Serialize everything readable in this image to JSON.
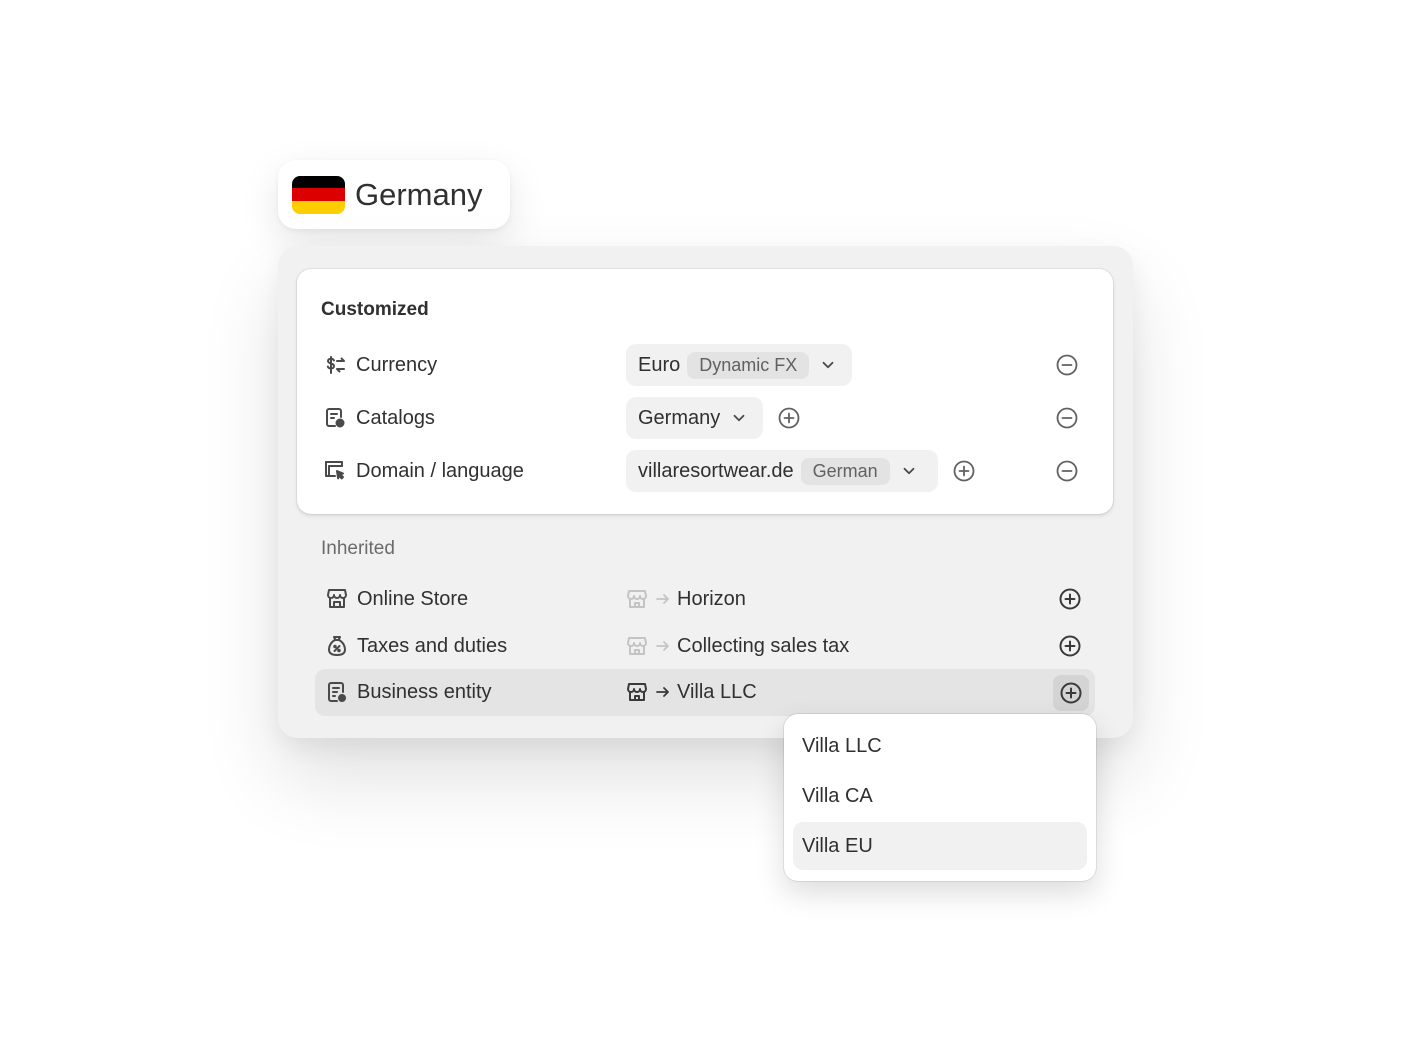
{
  "country": {
    "name": "Germany",
    "flag_colors": [
      "#000000",
      "#dd0000",
      "#ffce00"
    ]
  },
  "customized": {
    "title": "Customized",
    "rows": [
      {
        "label": "Currency",
        "icon": "currency-exchange-icon",
        "value": "Euro",
        "pill": "Dynamic FX",
        "has_add": false
      },
      {
        "label": "Catalogs",
        "icon": "catalog-icon",
        "value": "Germany",
        "pill": "",
        "has_add": true
      },
      {
        "label": "Domain / language",
        "icon": "domain-icon",
        "value": "villaresortwear.de",
        "pill": "German",
        "has_add": true
      }
    ]
  },
  "inherited": {
    "title": "Inherited",
    "rows": [
      {
        "label": "Online Store",
        "icon": "online-store-icon",
        "value": "Horizon",
        "active": false
      },
      {
        "label": "Taxes and duties",
        "icon": "tax-bag-icon",
        "value": "Collecting sales tax",
        "active": false
      },
      {
        "label": "Business entity",
        "icon": "business-entity-icon",
        "value": "Villa LLC",
        "active": true
      }
    ]
  },
  "dropdown": {
    "items": [
      "Villa LLC",
      "Villa CA",
      "Villa EU"
    ],
    "highlighted": "Villa EU"
  },
  "colors": {
    "text": "#303030",
    "panel": "#f1f1f1",
    "muted": "#6b6b6b"
  }
}
